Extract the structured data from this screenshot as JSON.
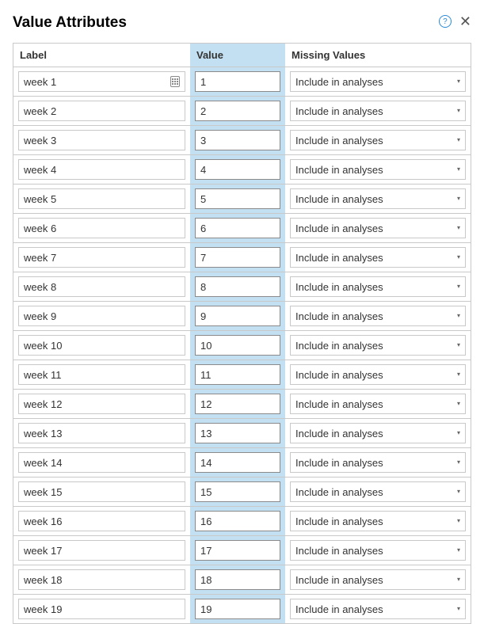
{
  "title": "Value Attributes",
  "columns": {
    "label": "Label",
    "value": "Value",
    "missing": "Missing Values"
  },
  "missing_default": "Include in analyses",
  "rows": [
    {
      "label": "week 1",
      "value": "1",
      "missing": "Include in analyses",
      "show_keypad": true
    },
    {
      "label": "week 2",
      "value": "2",
      "missing": "Include in analyses",
      "show_keypad": false
    },
    {
      "label": "week 3",
      "value": "3",
      "missing": "Include in analyses",
      "show_keypad": false
    },
    {
      "label": "week 4",
      "value": "4",
      "missing": "Include in analyses",
      "show_keypad": false
    },
    {
      "label": "week 5",
      "value": "5",
      "missing": "Include in analyses",
      "show_keypad": false
    },
    {
      "label": "week 6",
      "value": "6",
      "missing": "Include in analyses",
      "show_keypad": false
    },
    {
      "label": "week 7",
      "value": "7",
      "missing": "Include in analyses",
      "show_keypad": false
    },
    {
      "label": "week 8",
      "value": "8",
      "missing": "Include in analyses",
      "show_keypad": false
    },
    {
      "label": "week 9",
      "value": "9",
      "missing": "Include in analyses",
      "show_keypad": false
    },
    {
      "label": "week 10",
      "value": "10",
      "missing": "Include in analyses",
      "show_keypad": false
    },
    {
      "label": "week 11",
      "value": "11",
      "missing": "Include in analyses",
      "show_keypad": false
    },
    {
      "label": "week 12",
      "value": "12",
      "missing": "Include in analyses",
      "show_keypad": false
    },
    {
      "label": "week 13",
      "value": "13",
      "missing": "Include in analyses",
      "show_keypad": false
    },
    {
      "label": "week 14",
      "value": "14",
      "missing": "Include in analyses",
      "show_keypad": false
    },
    {
      "label": "week 15",
      "value": "15",
      "missing": "Include in analyses",
      "show_keypad": false
    },
    {
      "label": "week 16",
      "value": "16",
      "missing": "Include in analyses",
      "show_keypad": false
    },
    {
      "label": "week 17",
      "value": "17",
      "missing": "Include in analyses",
      "show_keypad": false
    },
    {
      "label": "week 18",
      "value": "18",
      "missing": "Include in analyses",
      "show_keypad": false
    },
    {
      "label": "week 19",
      "value": "19",
      "missing": "Include in analyses",
      "show_keypad": false
    }
  ]
}
